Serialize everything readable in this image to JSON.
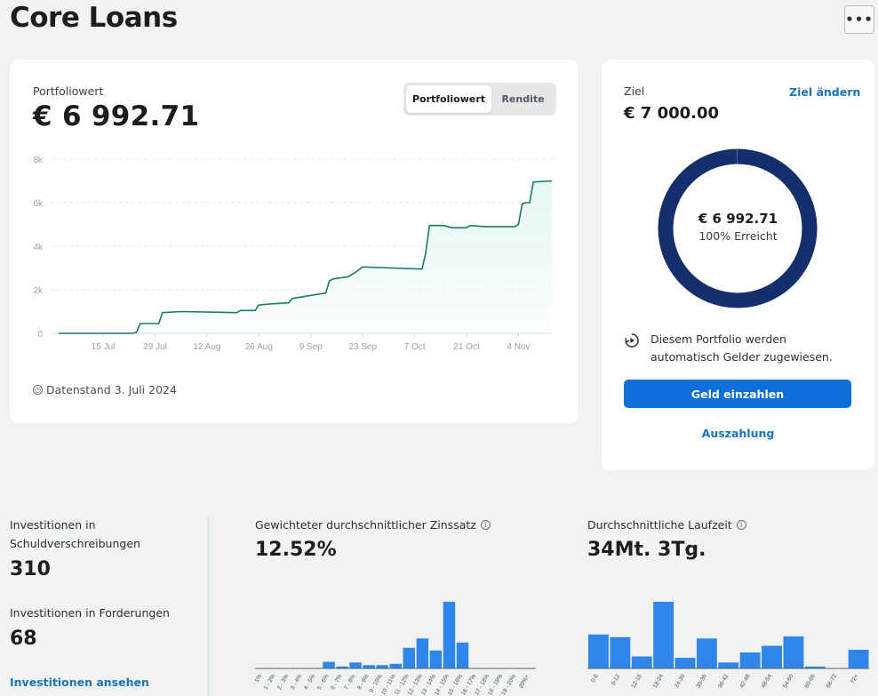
{
  "page": {
    "title": "Core Loans",
    "more_label": "•••"
  },
  "portfolio": {
    "label": "Portfoliowert",
    "value": "€ 6 992.71",
    "toggle": {
      "active": "Portfoliowert",
      "inactive": "Rendite"
    },
    "datenstand": "Datenstand 3. Juli 2024",
    "chart_data": {
      "type": "area",
      "y_ticks": [
        "0",
        "2k",
        "4k",
        "6k",
        "8k"
      ],
      "ylim": [
        0,
        8000
      ],
      "x_ticks": [
        "15 Jul",
        "29 Jul",
        "12 Aug",
        "26 Aug",
        "9 Sep",
        "23 Sep",
        "7 Oct",
        "21 Oct",
        "4 Nov"
      ],
      "x_tick_days": [
        12,
        26,
        40,
        54,
        68,
        82,
        96,
        110,
        124
      ],
      "xlim": [
        0,
        133
      ],
      "points": [
        [
          0,
          0
        ],
        [
          20,
          0
        ],
        [
          21,
          50
        ],
        [
          22,
          450
        ],
        [
          27,
          450
        ],
        [
          28,
          950
        ],
        [
          33,
          1000
        ],
        [
          48,
          950
        ],
        [
          49,
          1050
        ],
        [
          53,
          1050
        ],
        [
          54,
          1300
        ],
        [
          57,
          1350
        ],
        [
          62,
          1400
        ],
        [
          63,
          1600
        ],
        [
          70,
          1800
        ],
        [
          72,
          1850
        ],
        [
          73,
          2400
        ],
        [
          74,
          2500
        ],
        [
          78,
          2600
        ],
        [
          80,
          2800
        ],
        [
          82,
          3050
        ],
        [
          90,
          3000
        ],
        [
          98,
          2950
        ],
        [
          99,
          3700
        ],
        [
          100,
          4950
        ],
        [
          104,
          4950
        ],
        [
          106,
          4850
        ],
        [
          110,
          4850
        ],
        [
          111,
          4950
        ],
        [
          115,
          4900
        ],
        [
          120,
          4900
        ],
        [
          123,
          4900
        ],
        [
          124,
          5000
        ],
        [
          125,
          5950
        ],
        [
          126,
          6000
        ],
        [
          127,
          6000
        ],
        [
          128,
          6950
        ],
        [
          133,
          7000
        ]
      ],
      "colors": {
        "line": "#1a7a66",
        "fill": "#e6f7f2"
      }
    }
  },
  "goal": {
    "label": "Ziel",
    "change_label": "Ziel ändern",
    "value": "€ 7 000.00",
    "donut_amount": "€ 6 992.71",
    "donut_pct": "100% Erreicht",
    "progress": 0.999,
    "auto_text": "Diesem Portfolio werden automatisch Gelder zugewiesen.",
    "deposit_label": "Geld einzahlen",
    "payout_label": "Auszahlung",
    "colors": {
      "ring": "#142f6b",
      "button": "#0f6fd9"
    }
  },
  "stats": {
    "inv_bonds_label": "Investitionen in Schuldverschreibungen",
    "inv_bonds_value": "310",
    "inv_claims_label": "Investitionen in Forderungen",
    "inv_claims_value": "68",
    "view_link": "Investitionen ansehen"
  },
  "interest": {
    "label": "Gewichteter durchschnittlicher Zinssatz",
    "value": "12.52%",
    "chart_data": {
      "type": "bar",
      "categories": [
        "0 - 1%",
        "1 - 2%",
        "2 - 3%",
        "3 - 4%",
        "4 - 5%",
        "5 - 6%",
        "6 - 7%",
        "7 - 8%",
        "8 - 9%",
        "9 - 10%",
        "10 - 11%",
        "11 - 12%",
        "12 - 13%",
        "13 - 14%",
        "14 - 15%",
        "15 - 16%",
        "16 - 17%",
        "17 - 18%",
        "18 - 19%",
        "19 - 20%",
        "20%+"
      ],
      "values": [
        0,
        0,
        0,
        0,
        0,
        10,
        3,
        9,
        5,
        5,
        7,
        31,
        45,
        27,
        100,
        39,
        0,
        0,
        0,
        0,
        0
      ],
      "color": "#2f86e8"
    }
  },
  "duration": {
    "label": "Durchschnittliche Laufzeit",
    "value": "34Mt. 3Tg.",
    "chart_data": {
      "type": "bar",
      "categories": [
        "0-6",
        "6-12",
        "12-18",
        "18-24",
        "24-30",
        "30-36",
        "36-42",
        "42-48",
        "48-54",
        "54-60",
        "60-66",
        "66-72",
        "72+"
      ],
      "values": [
        51,
        47,
        18,
        100,
        16,
        45,
        9,
        24,
        34,
        48,
        3,
        0,
        28
      ],
      "color": "#2f86e8"
    }
  }
}
